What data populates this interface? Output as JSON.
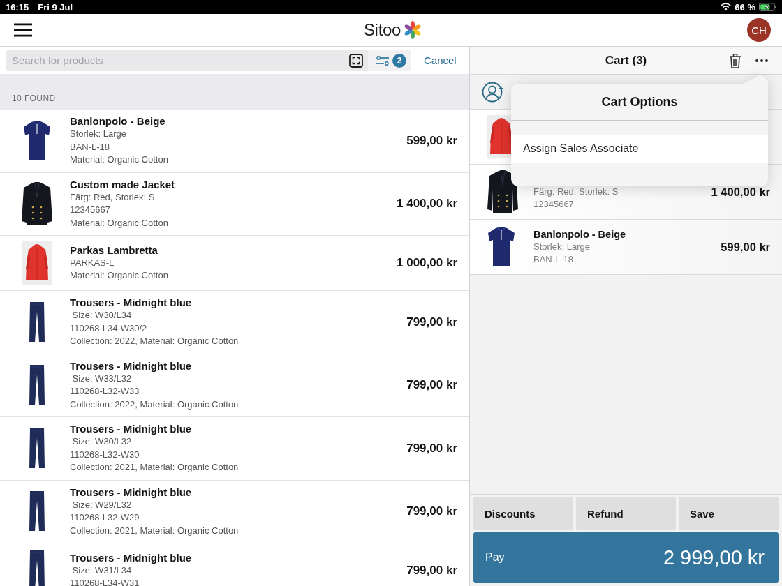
{
  "status_bar": {
    "time": "16:15",
    "date": "Fri 9 Jul",
    "battery": "66 %"
  },
  "header": {
    "logo": "Sitoo",
    "avatar": "CH"
  },
  "search": {
    "placeholder": "Search for products",
    "filter_count": "2",
    "cancel": "Cancel"
  },
  "results": {
    "count_label": "10 FOUND",
    "products": [
      {
        "kind": "polo",
        "title": "Banlonpolo - Beige",
        "details": [
          "Storlek: Large",
          "BAN-L-18",
          "Material: Organic Cotton"
        ],
        "price": "599,00 kr"
      },
      {
        "kind": "jacket",
        "title": "Custom made Jacket",
        "details": [
          "Färg: Red, Storlek: S",
          "12345667",
          "Material: Organic Cotton"
        ],
        "price": "1 400,00 kr"
      },
      {
        "kind": "parka",
        "title": "Parkas Lambretta",
        "details": [
          "PARKAS-L",
          "Material: Organic Cotton"
        ],
        "price": "1 000,00 kr"
      },
      {
        "kind": "trousers",
        "title": "Trousers - Midnight blue",
        "details": [
          " Size: W30/L34",
          "110268-L34-W30/2",
          "Collection: 2022, Material: Organic Cotton"
        ],
        "price": "799,00 kr"
      },
      {
        "kind": "trousers",
        "title": "Trousers - Midnight blue",
        "details": [
          " Size: W33/L32",
          "110268-L32-W33",
          "Collection: 2022, Material: Organic Cotton"
        ],
        "price": "799,00 kr"
      },
      {
        "kind": "trousers",
        "title": "Trousers - Midnight blue",
        "details": [
          " Size: W30/L32",
          "110268-L32-W30",
          "Collection: 2021, Material: Organic Cotton"
        ],
        "price": "799,00 kr"
      },
      {
        "kind": "trousers",
        "title": "Trousers - Midnight blue",
        "details": [
          " Size: W29/L32",
          "110268-L32-W29",
          "Collection: 2021, Material: Organic Cotton"
        ],
        "price": "799,00 kr"
      },
      {
        "kind": "trousers",
        "title": "Trousers - Midnight blue",
        "details": [
          " Size: W31/L34",
          "110268-L34-W31"
        ],
        "price": "799,00 kr"
      }
    ]
  },
  "cart": {
    "title": "Cart (3)",
    "items": [
      {
        "kind": "parka"
      },
      {
        "kind": "jacket",
        "details": [
          "Färg: Red, Storlek: S",
          "12345667"
        ],
        "price": "1 400,00 kr"
      },
      {
        "kind": "polo",
        "title": "Banlonpolo - Beige",
        "details": [
          "Storlek: Large",
          "BAN-L-18"
        ],
        "price": "599,00 kr"
      }
    ],
    "actions": [
      "Discounts",
      "Refund",
      "Save"
    ],
    "pay": {
      "label": "Pay",
      "amount": "2 999,00 kr"
    }
  },
  "cart_options": {
    "title": "Cart Options",
    "items": [
      "Assign Sales Associate"
    ]
  }
}
